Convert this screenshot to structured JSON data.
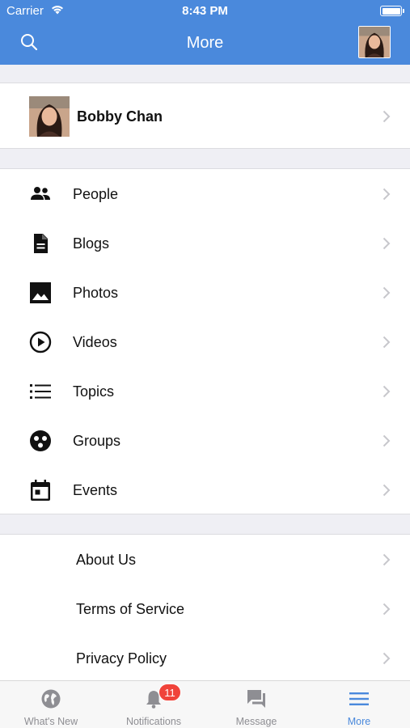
{
  "status_bar": {
    "carrier": "Carrier",
    "time": "8:43 PM"
  },
  "nav": {
    "title": "More"
  },
  "profile": {
    "name": "Bobby Chan"
  },
  "menu": [
    {
      "label": "People",
      "icon": "people-icon"
    },
    {
      "label": "Blogs",
      "icon": "document-icon"
    },
    {
      "label": "Photos",
      "icon": "image-icon"
    },
    {
      "label": "Videos",
      "icon": "play-circle-icon"
    },
    {
      "label": "Topics",
      "icon": "list-icon"
    },
    {
      "label": "Groups",
      "icon": "groups-icon"
    },
    {
      "label": "Events",
      "icon": "calendar-icon"
    }
  ],
  "links": [
    {
      "label": "About Us"
    },
    {
      "label": "Terms of Service"
    },
    {
      "label": "Privacy Policy"
    }
  ],
  "tabs": [
    {
      "label": "What's New",
      "icon": "globe-icon"
    },
    {
      "label": "Notifications",
      "icon": "bell-icon",
      "badge": "11"
    },
    {
      "label": "Message",
      "icon": "chat-icon"
    },
    {
      "label": "More",
      "icon": "menu-icon",
      "active": true
    }
  ],
  "colors": {
    "accent": "#4a89dc",
    "badge": "#f0433a",
    "inactive": "#8e8e93"
  }
}
